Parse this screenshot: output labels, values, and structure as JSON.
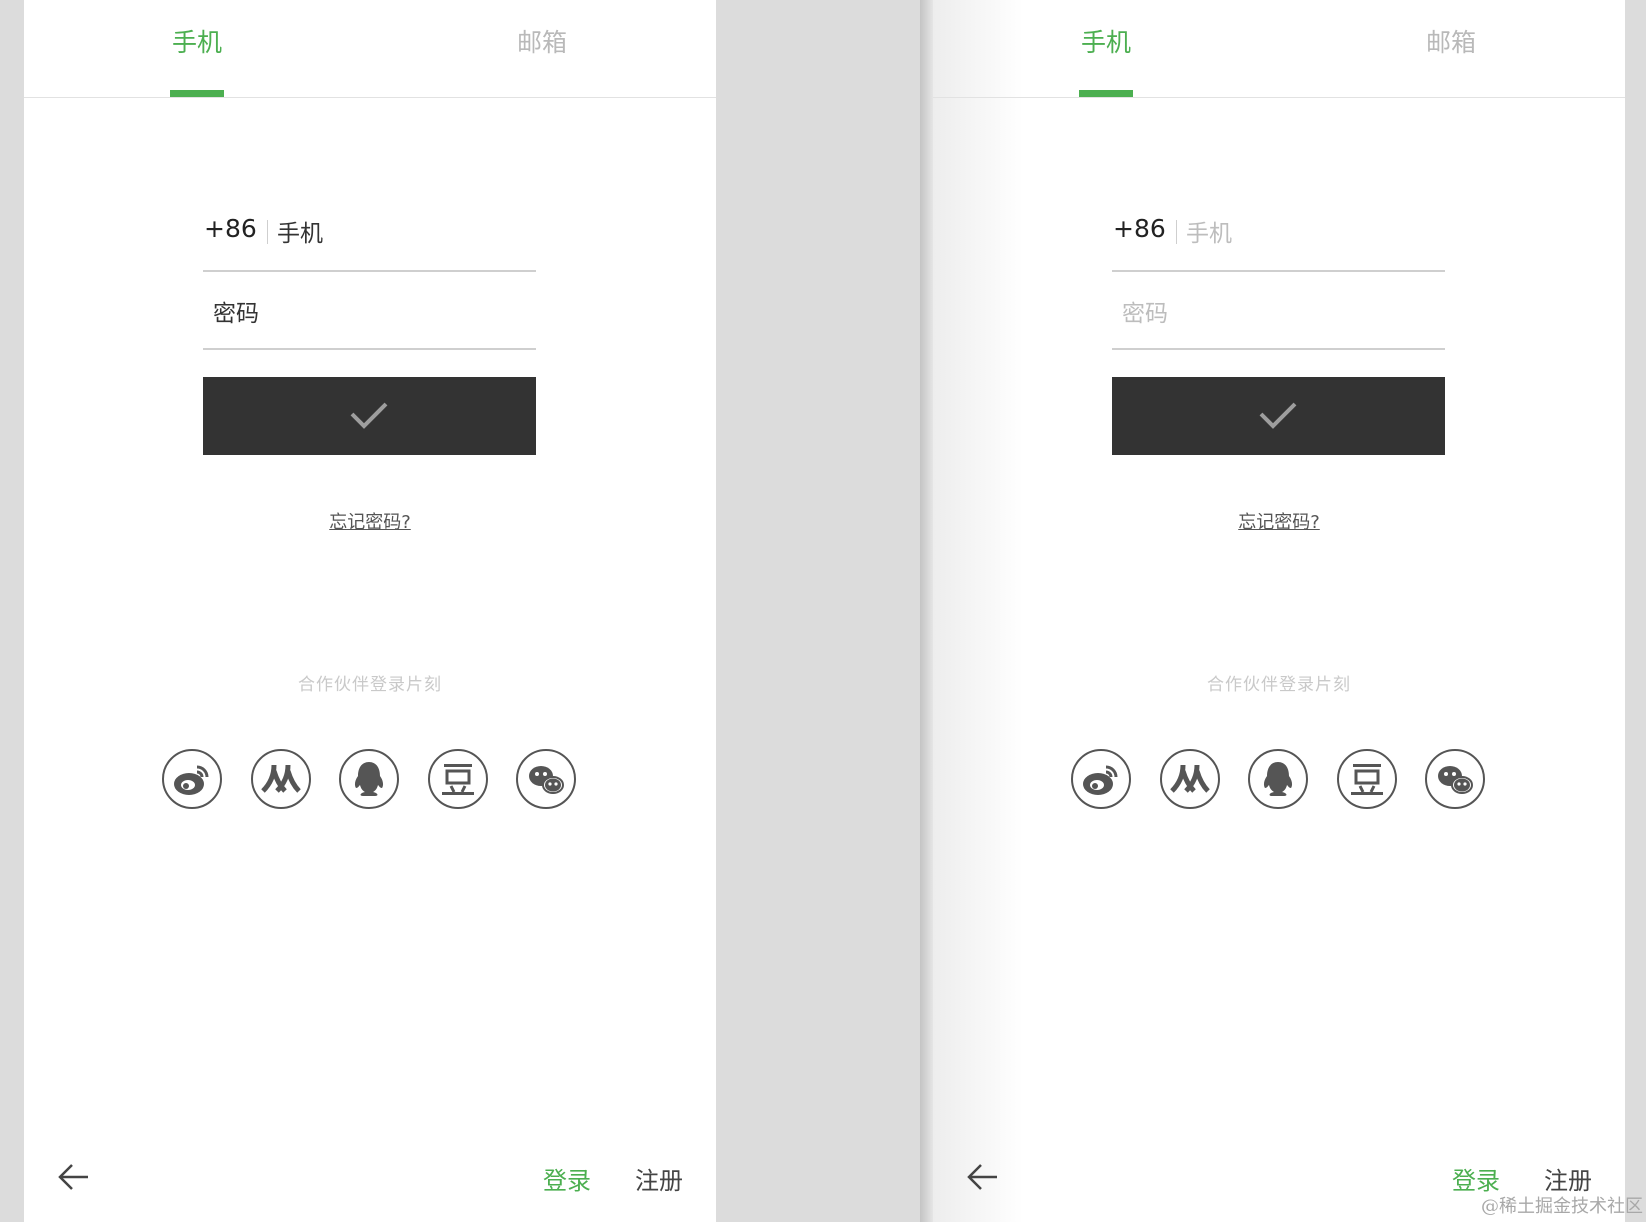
{
  "screens": [
    {
      "state": "filled",
      "tabs": {
        "active": "手机",
        "inactive": "邮箱"
      },
      "phone": {
        "country_code": "+86",
        "placeholder": "手机"
      },
      "password": {
        "placeholder": "密码"
      },
      "forgot_link": "忘记密码?",
      "partner_login_text": "合作伙伴登录片刻",
      "social_icons": [
        "weibo-icon",
        "renren-icon",
        "qq-icon",
        "douban-icon",
        "wechat-icon"
      ],
      "footer": {
        "login": "登录",
        "register": "注册"
      }
    },
    {
      "state": "empty",
      "tabs": {
        "active": "手机",
        "inactive": "邮箱"
      },
      "phone": {
        "country_code": "+86",
        "placeholder": "手机"
      },
      "password": {
        "placeholder": "密码"
      },
      "forgot_link": "忘记密码?",
      "partner_login_text": "合作伙伴登录片刻",
      "social_icons": [
        "weibo-icon",
        "renren-icon",
        "qq-icon",
        "douban-icon",
        "wechat-icon"
      ],
      "footer": {
        "login": "登录",
        "register": "注册"
      }
    }
  ],
  "watermark": "@稀土掘金技术社区",
  "colors": {
    "accent": "#4caf50",
    "button": "#333333",
    "background": "#dcdcdc"
  }
}
